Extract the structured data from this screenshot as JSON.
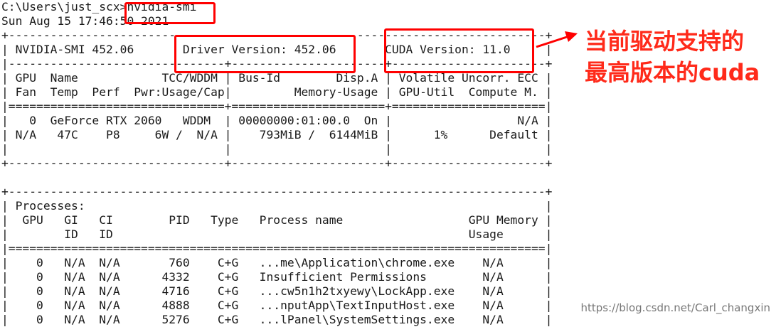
{
  "console": {
    "lines": [
      "C:\\Users\\just_scx>nvidia-smi",
      "Sun Aug 15 17:46:50 2021",
      "+-----------------------------------------------------------------------------+",
      "| NVIDIA-SMI 452.06       Driver Version: 452.06       CUDA Version: 11.0     |",
      "|-------------------------------+----------------------+----------------------+",
      "| GPU  Name            TCC/WDDM | Bus-Id        Disp.A | Volatile Uncorr. ECC |",
      "| Fan  Temp  Perf  Pwr:Usage/Cap|         Memory-Usage | GPU-Util  Compute M. |",
      "|===============================+======================+======================|",
      "|   0  GeForce RTX 2060   WDDM  | 00000000:01:00.0  On |                  N/A |",
      "| N/A   47C    P8     6W /  N/A |    793MiB /  6144MiB |      1%      Default |",
      "|                               |                      |                      |",
      "+-------------------------------+----------------------+----------------------+",
      "",
      "+-----------------------------------------------------------------------------+",
      "| Processes:                                                                  |",
      "|  GPU   GI   CI        PID   Type   Process name                  GPU Memory |",
      "|        ID   ID                                                   Usage      |",
      "|=============================================================================|",
      "|    0   N/A  N/A       760    C+G   ...me\\Application\\chrome.exe    N/A      |",
      "|    0   N/A  N/A      4332    C+G   Insufficient Permissions        N/A      |",
      "|    0   N/A  N/A      4716    C+G   ...cw5n1h2txyewy\\LockApp.exe    N/A      |",
      "|    0   N/A  N/A      4888    C+G   ...nputApp\\TextInputHost.exe    N/A      |",
      "|    0   N/A  N/A      5276    C+G   ...lPanel\\SystemSettings.exe    N/A      |"
    ]
  },
  "annotation": {
    "line1": "当前驱动支持的",
    "line2": "最高版本的cuda",
    "color": "#ff2a1a"
  },
  "watermark": "https://blog.csdn.net/Carl_changxin"
}
